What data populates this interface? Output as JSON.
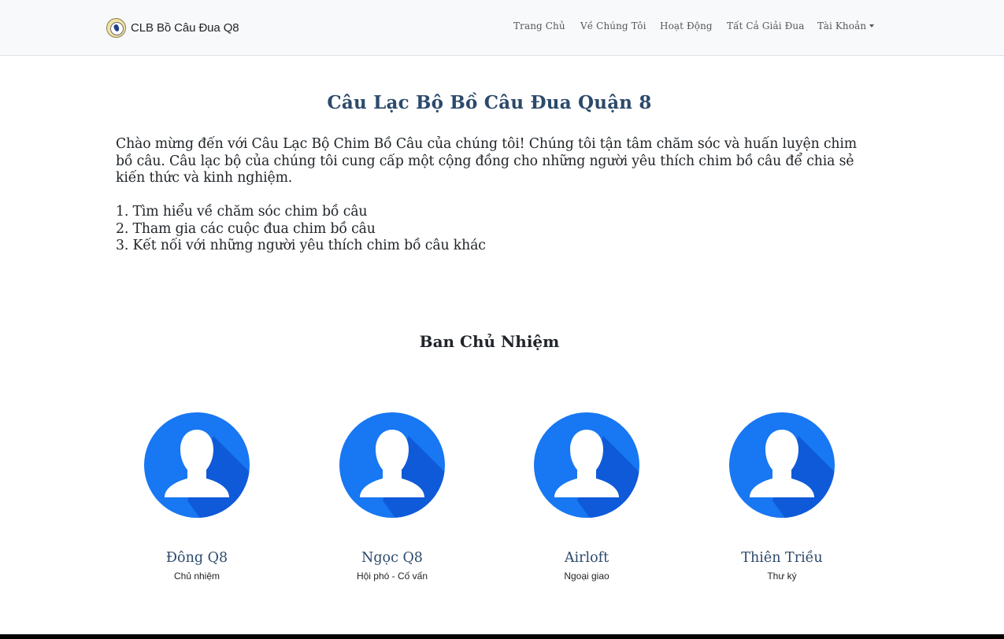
{
  "navbar": {
    "brand": "CLB Bồ Câu Đua Q8",
    "links": [
      {
        "label": "Trang Chủ"
      },
      {
        "label": "Về Chúng Tôi"
      },
      {
        "label": "Hoạt Động"
      },
      {
        "label": "Tất Cả Giải Đua"
      },
      {
        "label": "Tài Khoản"
      }
    ]
  },
  "main": {
    "title": "Câu Lạc Bộ Bồ Câu Đua Quận 8",
    "intro": "Chào mừng đến với Câu Lạc Bộ Chim Bồ Câu của chúng tôi! Chúng tôi tận tâm chăm sóc và huấn luyện chim bồ câu. Câu lạc bộ của chúng tôi cung cấp một cộng đồng cho những người yêu thích chim bồ câu để chia sẻ kiến thức và kinh nghiệm.",
    "list": [
      "1. Tìm hiểu về chăm sóc chim bồ câu",
      "2. Tham gia các cuộc đua chim bồ câu",
      "3. Kết nối với những người yêu thích chim bồ câu khác"
    ]
  },
  "team": {
    "title": "Ban Chủ Nhiệm",
    "members": [
      {
        "name": "Đông Q8",
        "role": "Chủ nhiệm",
        "avatar_icon": "user-silhouette-icon"
      },
      {
        "name": "Ngọc Q8",
        "role": "Hội phó - Cố vấn",
        "avatar_icon": "user-silhouette-icon"
      },
      {
        "name": "Airloft",
        "role": "Ngoại giao",
        "avatar_icon": "user-silhouette-icon"
      },
      {
        "name": "Thiên Triều",
        "role": "Thư ký",
        "avatar_icon": "user-silhouette-icon"
      }
    ]
  },
  "colors": {
    "avatar_blue": "#1877f2",
    "avatar_shadow": "#0f5ad8",
    "heading": "#2c4a6b",
    "navbar_bg": "#f8f9fa"
  }
}
